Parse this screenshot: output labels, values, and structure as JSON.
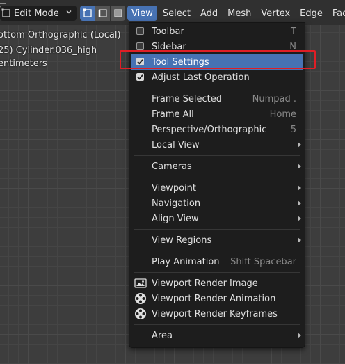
{
  "header": {
    "mode_label": "Edit Mode",
    "menus": [
      "View",
      "Select",
      "Add",
      "Mesh",
      "Vertex",
      "Edge",
      "Fac"
    ]
  },
  "viewport": {
    "line1": "ottom Orthographic (Local)",
    "line2": "25) Cylinder.036_high",
    "line3": "entimeters"
  },
  "view_menu": {
    "toolbar": {
      "label": "Toolbar",
      "shortcut": "T"
    },
    "sidebar": {
      "label": "Sidebar",
      "shortcut": "N"
    },
    "tool_settings": {
      "label": "Tool Settings"
    },
    "adjust_last": {
      "label": "Adjust Last Operation"
    },
    "frame_selected": {
      "label": "Frame Selected",
      "shortcut": "Numpad ."
    },
    "frame_all": {
      "label": "Frame All",
      "shortcut": "Home"
    },
    "persp_ortho": {
      "label": "Perspective/Orthographic",
      "shortcut": "5"
    },
    "local_view": {
      "label": "Local View"
    },
    "cameras": {
      "label": "Cameras"
    },
    "viewpoint": {
      "label": "Viewpoint"
    },
    "navigation": {
      "label": "Navigation"
    },
    "align_view": {
      "label": "Align View"
    },
    "view_regions": {
      "label": "View Regions"
    },
    "play_animation": {
      "label": "Play Animation",
      "shortcut": "Shift Spacebar"
    },
    "render_image": {
      "label": "Viewport Render Image"
    },
    "render_animation": {
      "label": "Viewport Render Animation"
    },
    "render_keyframes": {
      "label": "Viewport Render Keyframes"
    },
    "area": {
      "label": "Area"
    }
  },
  "colors": {
    "accent": "#4772b3",
    "highlight_box": "#e01e25",
    "menu_bg": "#1d1d1d"
  }
}
